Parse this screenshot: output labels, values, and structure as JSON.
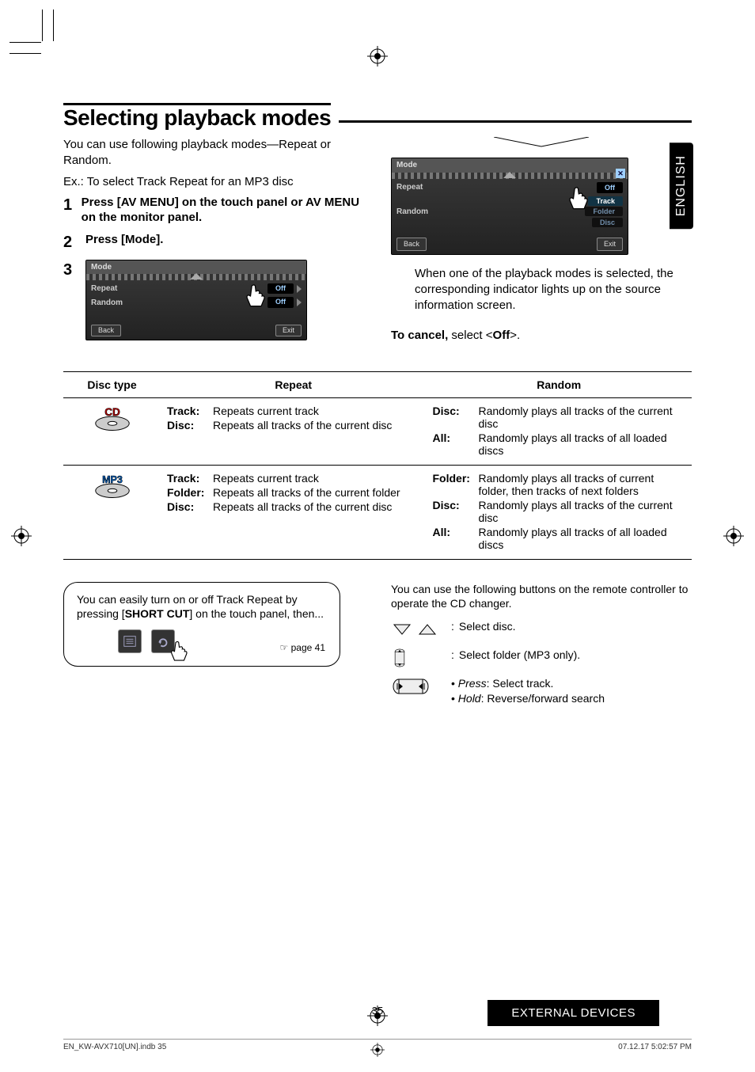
{
  "sideTab": "ENGLISH",
  "title": "Selecting playback modes",
  "intro1": "You can use following playback modes—Repeat or Random.",
  "intro2": "Ex.: To select Track Repeat for an MP3 disc",
  "steps": {
    "s1": "Press [AV MENU] on the touch panel or AV MENU on the monitor panel.",
    "s2": "Press [Mode].",
    "s3": ""
  },
  "screenA": {
    "title": "Mode",
    "rows": [
      {
        "k": "Repeat",
        "v": "Off"
      },
      {
        "k": "Random",
        "v": "Off"
      }
    ],
    "back": "Back",
    "exit": "Exit"
  },
  "screenB": {
    "title": "Mode",
    "rows": [
      {
        "k": "Repeat",
        "v": "Off"
      },
      {
        "k": "Random",
        "v": "Track",
        "sub1": "Folder",
        "sub2": "Disc"
      }
    ],
    "back": "Back",
    "exit": "Exit"
  },
  "afterScreen": "When one of the playback modes is selected, the corresponding indicator lights up on the source information screen.",
  "cancelLead": "To cancel,",
  "cancelRest": " select <",
  "cancelOff": "Off",
  "cancelEnd": ">.",
  "table": {
    "h1": "Disc type",
    "h2": "Repeat",
    "h3": "Random",
    "cdLabel": "CD",
    "mp3Label": "MP3",
    "cd": {
      "repeat": [
        {
          "k": "Track:",
          "v": "Repeats current track"
        },
        {
          "k": "Disc:",
          "v": "Repeats all tracks of the current disc"
        }
      ],
      "random": [
        {
          "k": "Disc:",
          "v": "Randomly plays all tracks of the current disc"
        },
        {
          "k": "All:",
          "v": "Randomly plays all tracks of all loaded discs"
        }
      ]
    },
    "mp3": {
      "repeat": [
        {
          "k": "Track:",
          "v": "Repeats current track"
        },
        {
          "k": "Folder:",
          "v": "Repeats all tracks of the current folder"
        },
        {
          "k": "Disc:",
          "v": "Repeats all tracks of the current disc"
        }
      ],
      "random": [
        {
          "k": "Folder:",
          "v": "Randomly plays all tracks of current folder, then tracks of next folders"
        },
        {
          "k": "Disc:",
          "v": "Randomly plays all tracks of the current disc"
        },
        {
          "k": "All:",
          "v": "Randomly plays all tracks of all loaded discs"
        }
      ]
    }
  },
  "callout": {
    "line1a": "You can easily turn on or off Track Repeat by pressing [",
    "line1b": "SHORT CUT",
    "line1c": "] on the touch panel, then...",
    "pageRef": "☞ page 41"
  },
  "remote": {
    "intro": "You can use the following buttons on the remote controller to operate the CD changer.",
    "r1": "Select disc.",
    "r2": "Select folder (MP3 only).",
    "r3a": "Press",
    "r3aRest": ": Select track.",
    "r3b": "Hold",
    "r3bRest": ": Reverse/forward search"
  },
  "pageNumber": "35",
  "footerBar": "EXTERNAL DEVICES",
  "printLeft": "EN_KW-AVX710[UN].indb   35",
  "printRight": "07.12.17   5:02:57 PM"
}
